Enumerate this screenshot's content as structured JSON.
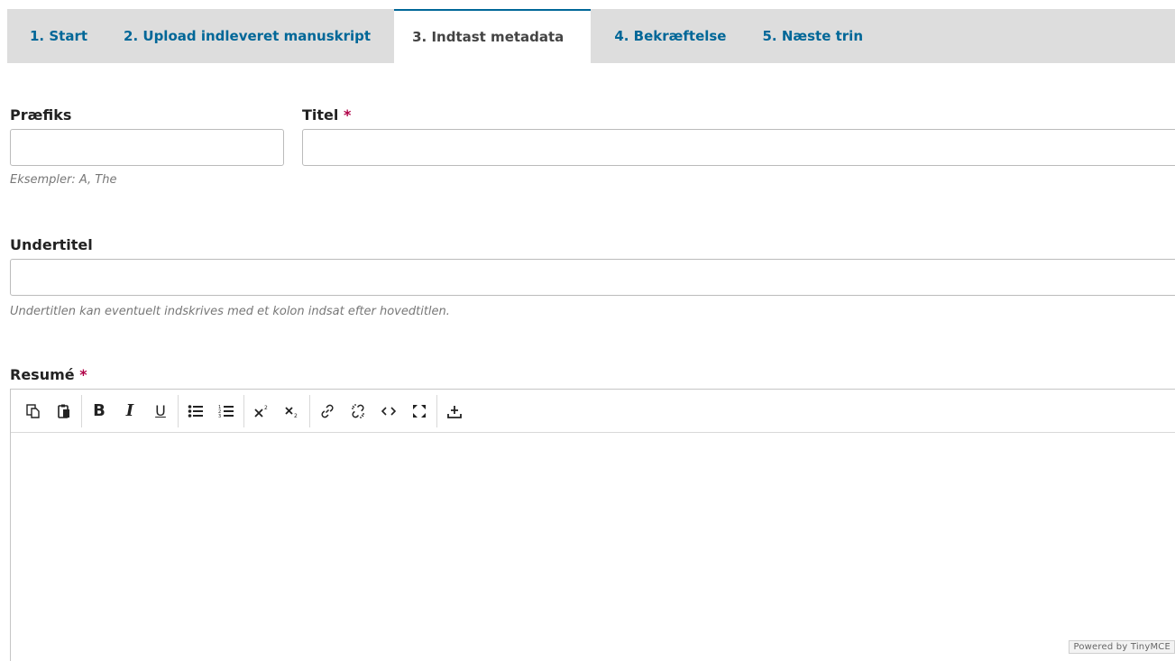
{
  "tabs": [
    {
      "label": "1. Start"
    },
    {
      "label": "2. Upload indleveret manuskript"
    },
    {
      "label": "3. Indtast metadata"
    },
    {
      "label": "4. Bekræftelse"
    },
    {
      "label": "5. Næste trin"
    }
  ],
  "active_tab": "3. Indtast metadata",
  "form": {
    "prefix": {
      "label": "Præfiks",
      "value": "",
      "help": "Eksempler: A, The"
    },
    "title": {
      "label": "Titel",
      "required_mark": "*",
      "value": ""
    },
    "subtitle": {
      "label": "Undertitel",
      "value": "",
      "help": "Undertitlen kan eventuelt indskrives med et kolon indsat efter hovedtitlen."
    },
    "abstract": {
      "label": "Resumé",
      "required_mark": "*",
      "value": ""
    }
  },
  "editor": {
    "toolbar_icons": [
      "copy-icon",
      "paste-icon",
      "bold-icon",
      "italic-icon",
      "underline-icon",
      "bullet-list-icon",
      "numbered-list-icon",
      "superscript-icon",
      "subscript-icon",
      "link-icon",
      "unlink-icon",
      "code-icon",
      "fullscreen-icon",
      "upload-icon"
    ],
    "bold_glyph": "B",
    "italic_glyph": "I",
    "underline_glyph": "U",
    "powered_by": "Powered by TinyMCE"
  },
  "colors": {
    "accent": "#006798",
    "required": "#b00047",
    "tab_bar": "#dddddd"
  }
}
